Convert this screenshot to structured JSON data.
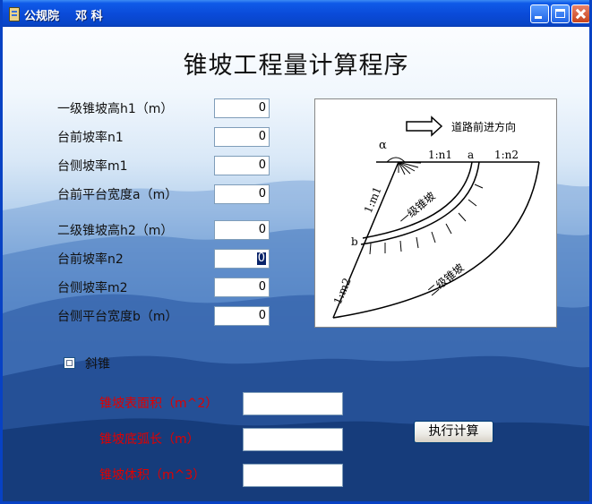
{
  "window": {
    "title": "公规院    邓 科"
  },
  "heading": "锥坡工程量计算程序",
  "inputs": [
    {
      "label": "一级锥坡高h1（m）",
      "value": "0"
    },
    {
      "label": "台前坡率n1",
      "value": "0"
    },
    {
      "label": "台侧坡率m1",
      "value": "0"
    },
    {
      "label": "台前平台宽度a（m）",
      "value": "0"
    },
    {
      "label": "二级锥坡高h2（m）",
      "value": "0"
    },
    {
      "label": "台前坡率n2",
      "value": "0"
    },
    {
      "label": "台侧坡率m2",
      "value": "0"
    },
    {
      "label": "台侧平台宽度b（m）",
      "value": "0"
    }
  ],
  "checkbox": {
    "label": "斜锥",
    "checked": false
  },
  "results": [
    {
      "label": "锥坡表面积（m^2）",
      "value": ""
    },
    {
      "label": "锥坡底弧长（m）",
      "value": ""
    },
    {
      "label": "锥坡体积（m^3）",
      "value": ""
    }
  ],
  "compute_button": "执行计算",
  "diagram": {
    "direction_label": "道路前进方向",
    "alpha": "α",
    "ratio_n1": "1:n1",
    "ratio_n2": "1:n2",
    "ratio_m1": "1:m1",
    "ratio_m2": "1:m2",
    "point_a": "a",
    "point_b": "b",
    "level1": "一级锥坡",
    "level2": "二级锥坡"
  },
  "colors": {
    "title_bar": "#0a4ad8",
    "result_label": "#e00000",
    "field_border": "#7f9db9"
  }
}
